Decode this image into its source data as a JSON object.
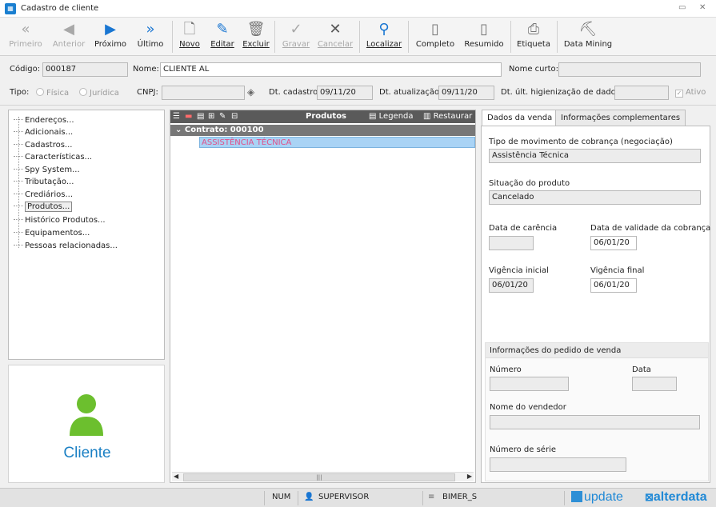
{
  "window": {
    "title": "Cadastro de cliente",
    "minimize": "▭",
    "close": "✕"
  },
  "toolbar": {
    "primeiro": "Primeiro",
    "anterior": "Anterior",
    "proximo": "Próximo",
    "ultimo": "Último",
    "novo": "Novo",
    "editar": "Editar",
    "excluir": "Excluir",
    "gravar": "Gravar",
    "cancelar": "Cancelar",
    "localizar": "Localizar",
    "completo": "Completo",
    "resumido": "Resumido",
    "etiqueta": "Etiqueta",
    "data_mining": "Data Mining"
  },
  "header": {
    "codigo_label": "Código:",
    "codigo_value": "000187",
    "nome_label": "Nome:",
    "nome_value": "CLIENTE AL",
    "nome_curto_label": "Nome curto:",
    "nome_curto_value": "",
    "tipo_label": "Tipo:",
    "fisica": "Física",
    "juridica": "Jurídica",
    "cnpj_label": "CNPJ:",
    "cnpj_value": "",
    "dt_cadastro_label": "Dt. cadastro:",
    "dt_cadastro_value": "09/11/20",
    "dt_atualizacao_label": "Dt. atualização:",
    "dt_atualizacao_value": "09/11/20",
    "dt_higienizacao_label": "Dt. últ. higienização de dados:",
    "dt_higienizacao_value": "",
    "ativo_label": "Ativo"
  },
  "nav": {
    "items": [
      "Endereços...",
      "Adicionais...",
      "Cadastros...",
      "Características...",
      "Spy System...",
      "Tributação...",
      "Crediários...",
      "Produtos...",
      "Histórico Produtos...",
      "Equipamentos...",
      "Pessoas relacionadas..."
    ],
    "selected_index": 7
  },
  "client": {
    "label": "Cliente"
  },
  "products": {
    "title": "Produtos",
    "legenda": "Legenda",
    "restaurar": "Restaurar",
    "contract": "Contrato: 000100",
    "item": "ASSISTÊNCIA TÉCNICA"
  },
  "tabs": {
    "dados_venda": "Dados da venda",
    "info_compl": "Informações complementares"
  },
  "venda": {
    "tipo_mov_label": "Tipo de movimento de cobrança (negociação)",
    "tipo_mov_value": "Assistência Técnica",
    "situacao_label": "Situação do produto",
    "situacao_value": "Cancelado",
    "carencia_label": "Data de carência",
    "carencia_value": "",
    "validade_label": "Data de validade da cobrança",
    "validade_value": "06/01/20",
    "vig_ini_label": "Vigência inicial",
    "vig_ini_value": "06/01/20",
    "vig_fin_label": "Vigência final",
    "vig_fin_value": "06/01/20"
  },
  "pedido": {
    "header": "Informações do pedido de venda",
    "numero_label": "Número",
    "data_label": "Data",
    "vendedor_label": "Nome do vendedor",
    "serie_label": "Número de série"
  },
  "status": {
    "num": "NUM",
    "user": "SUPERVISOR",
    "db": "BIMER_S",
    "logo_update": "update",
    "logo_alterdata": "alterdata"
  }
}
